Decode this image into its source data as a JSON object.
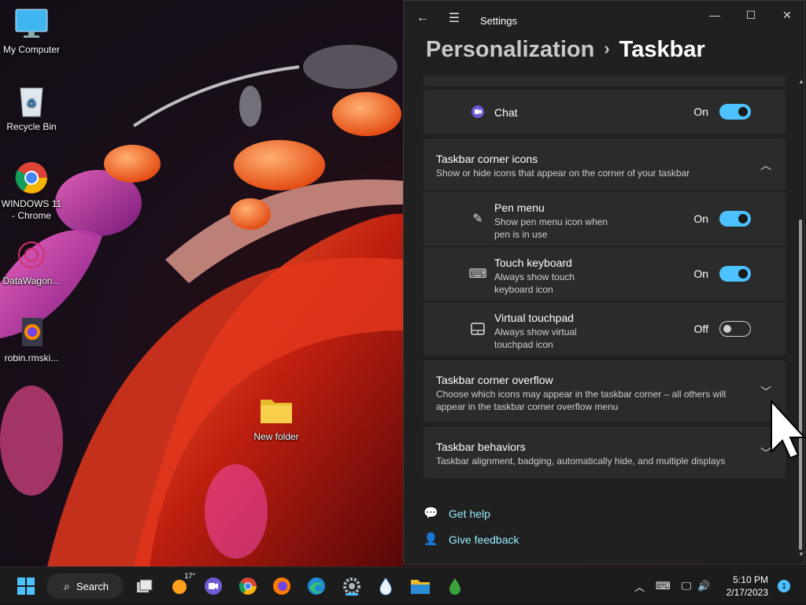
{
  "desktop": {
    "icons": [
      {
        "label": "My Computer"
      },
      {
        "label": "Recycle Bin"
      },
      {
        "label": "WINDOWS 11 - Chrome"
      },
      {
        "label": "DataWagon..."
      },
      {
        "label": "robin.rmski..."
      },
      {
        "label": "New folder"
      }
    ]
  },
  "window": {
    "title": "Settings",
    "breadcrumb": {
      "parent": "Personalization",
      "separator": "›",
      "current": "Taskbar"
    },
    "chat": {
      "label": "Chat",
      "state": "On",
      "on": true
    },
    "corner_icons": {
      "title": "Taskbar corner icons",
      "subtitle": "Show or hide icons that appear on the corner of your taskbar",
      "items": [
        {
          "title": "Pen menu",
          "sub1": "Show pen menu icon when",
          "sub2": "pen is in use",
          "state": "On",
          "on": true,
          "icon": "pen-icon"
        },
        {
          "title": "Touch keyboard",
          "sub1": "Always show touch",
          "sub2": "keyboard icon",
          "state": "On",
          "on": true,
          "icon": "keyboard-icon"
        },
        {
          "title": "Virtual touchpad",
          "sub1": "Always show virtual",
          "sub2": "touchpad icon",
          "state": "Off",
          "on": false,
          "icon": "touchpad-icon"
        }
      ]
    },
    "corner_overflow": {
      "title": "Taskbar corner overflow",
      "sub1": "Choose which icons may appear in the taskbar corner – all others will",
      "sub2": "appear in the taskbar corner overflow menu"
    },
    "behaviors": {
      "title": "Taskbar behaviors",
      "subtitle": "Taskbar alignment, badging, automatically hide, and multiple displays"
    },
    "links": {
      "help": "Get help",
      "feedback": "Give feedback"
    }
  },
  "taskbar": {
    "search_label": "Search",
    "weather_temp": "17°",
    "clock_time": "5:10 PM",
    "clock_date": "2/17/2023",
    "notification_count": "1"
  },
  "colors": {
    "accent": "#4cc2ff",
    "window_bg": "#202020",
    "card_bg": "#2b2b2b",
    "link": "#99ebff"
  }
}
